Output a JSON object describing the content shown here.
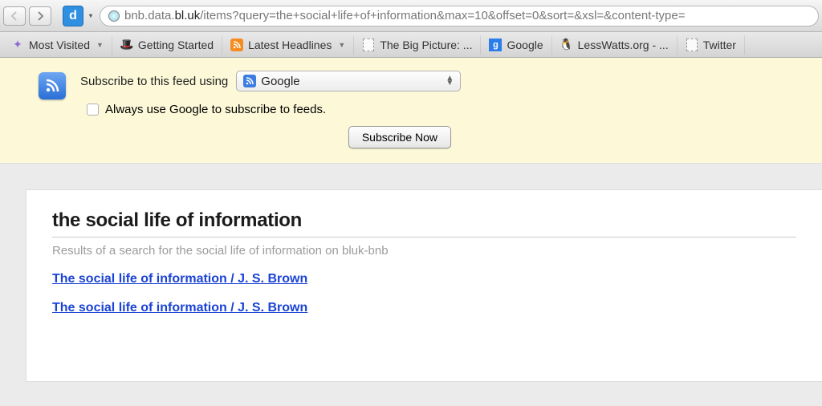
{
  "url": {
    "prefix": "bnb.data.",
    "host": "bl.uk",
    "path": "/items?query=the+social+life+of+information&max=10&offset=0&sort=&xsl=&content-type="
  },
  "bookmarks": [
    {
      "label": "Most Visited",
      "icon": "star",
      "chevron": true
    },
    {
      "label": "Getting Started",
      "icon": "redhat",
      "chevron": false
    },
    {
      "label": "Latest Headlines",
      "icon": "feed",
      "chevron": true
    },
    {
      "label": "The Big Picture: ...",
      "icon": "page",
      "chevron": false
    },
    {
      "label": "Google",
      "icon": "google",
      "chevron": false
    },
    {
      "label": "LessWatts.org - ...",
      "icon": "tux",
      "chevron": false
    },
    {
      "label": "Twitter",
      "icon": "page",
      "chevron": false
    }
  ],
  "feedbar": {
    "subscribe_label": "Subscribe to this feed using",
    "selected_reader": "Google",
    "always_label": "Always use Google to subscribe to feeds.",
    "subscribe_button": "Subscribe Now"
  },
  "feed": {
    "title": "the social life of information",
    "description": "Results of a search for the social life of information on bluk-bnb",
    "items": [
      "The social life of information / J. S. Brown",
      "The social life of information / J. S. Brown"
    ]
  }
}
